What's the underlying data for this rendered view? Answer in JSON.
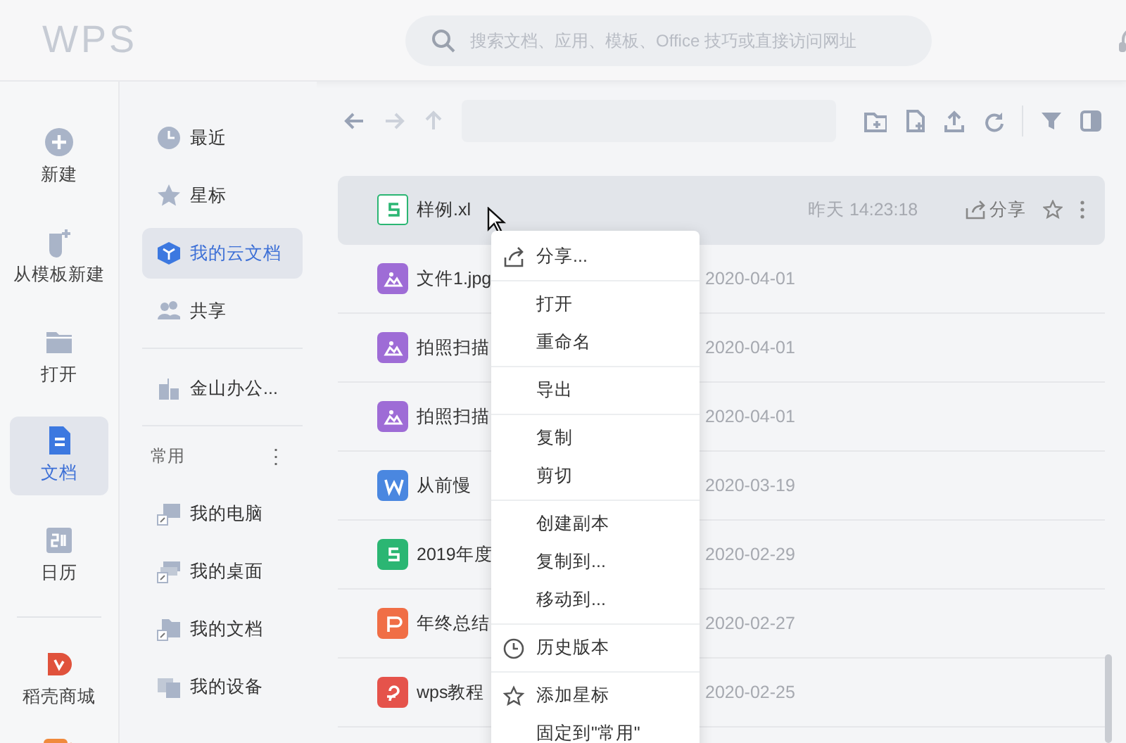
{
  "header": {
    "logo": "WPS",
    "search": {
      "placeholder": "搜索文档、应用、模板、Office 技巧或直接访问网址"
    }
  },
  "rail": {
    "top": [
      {
        "kind": "new",
        "label": "新建",
        "selected": false
      },
      {
        "kind": "template",
        "label": "从模板新建",
        "selected": false
      },
      {
        "kind": "open",
        "label": "打开",
        "selected": false
      },
      {
        "kind": "docs",
        "label": "文档",
        "selected": true
      },
      {
        "kind": "calendar",
        "label": "日历",
        "selected": false
      }
    ],
    "bottom": [
      {
        "kind": "shop",
        "label": "稻壳商城",
        "selected": false
      }
    ]
  },
  "nav": {
    "items": [
      {
        "kind": "recent",
        "label": "最近",
        "selected": false
      },
      {
        "kind": "star",
        "label": "星标",
        "selected": false
      },
      {
        "kind": "cloud",
        "label": "我的云文档",
        "selected": true
      },
      {
        "kind": "shared",
        "label": "共享",
        "selected": false
      }
    ],
    "team": [
      {
        "kind": "company",
        "label": "金山办公...",
        "selected": false
      }
    ],
    "common": {
      "title": "常用",
      "more": "⋮",
      "items": [
        {
          "kind": "computer",
          "label": "我的电脑",
          "selected": false
        },
        {
          "kind": "desktop",
          "label": "我的桌面",
          "selected": false
        },
        {
          "kind": "folder",
          "label": "我的文档",
          "selected": false
        },
        {
          "kind": "devices",
          "label": "我的设备",
          "selected": false
        }
      ]
    }
  },
  "files": [
    {
      "kind": "sheet",
      "name": "样例.xl",
      "date": "昨天 14:23:18",
      "selected": true,
      "share": "分享"
    },
    {
      "kind": "image",
      "name": "文件1.jpg",
      "date": "2020-04-01",
      "selected": false
    },
    {
      "kind": "image",
      "name": "拍照扫描",
      "date": "2020-04-01",
      "selected": false
    },
    {
      "kind": "image",
      "name": "拍照扫描",
      "date": "2020-04-01",
      "selected": false
    },
    {
      "kind": "writer",
      "name": "从前慢",
      "date": "2020-03-19",
      "selected": false
    },
    {
      "kind": "sheet",
      "name": "2019年度",
      "date": "2020-02-29",
      "selected": false
    },
    {
      "kind": "ppt",
      "name": "年终总结",
      "date": "2020-02-27",
      "selected": false
    },
    {
      "kind": "pdf",
      "name": "wps教程",
      "date": "2020-02-25",
      "selected": false
    }
  ],
  "context_menu": [
    [
      {
        "kind": "share",
        "label": "分享..."
      }
    ],
    [
      {
        "label": "打开"
      },
      {
        "label": "重命名"
      }
    ],
    [
      {
        "label": "导出"
      }
    ],
    [
      {
        "label": "复制"
      },
      {
        "label": "剪切"
      }
    ],
    [
      {
        "label": "创建副本"
      },
      {
        "label": "复制到..."
      },
      {
        "label": "移动到..."
      }
    ],
    [
      {
        "kind": "history",
        "label": "历史版本"
      }
    ],
    [
      {
        "kind": "star",
        "label": "添加星标"
      },
      {
        "label": "固定到\"常用\""
      }
    ]
  ]
}
